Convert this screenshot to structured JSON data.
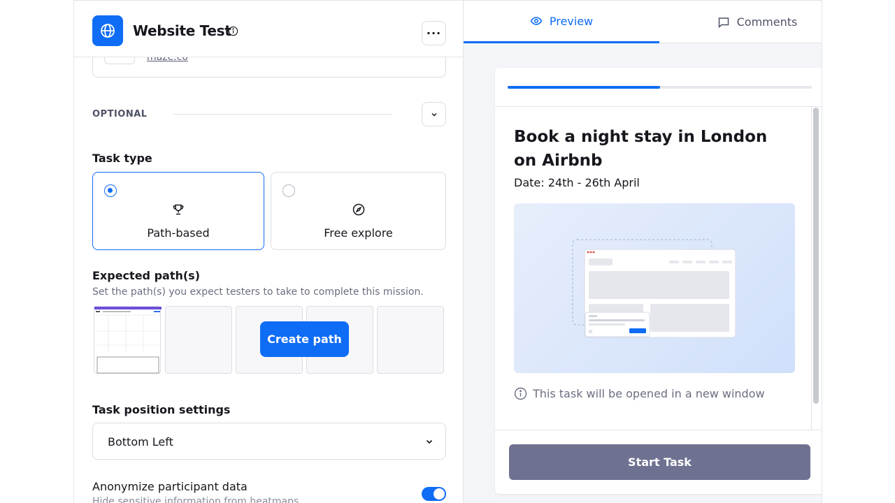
{
  "header": {
    "title": "Website Test",
    "more_label": "···"
  },
  "url_card": {
    "url": "maze.co"
  },
  "optional": {
    "label": "OPTIONAL"
  },
  "task_type": {
    "label": "Task type",
    "options": [
      {
        "label": "Path-based",
        "selected": true,
        "icon": "trophy-icon"
      },
      {
        "label": "Free explore",
        "selected": false,
        "icon": "compass-icon"
      }
    ]
  },
  "expected_paths": {
    "label": "Expected path(s)",
    "description": "Set the path(s) you expect testers to take to complete this mission.",
    "create_label": "Create path"
  },
  "task_position": {
    "label": "Task position settings",
    "value": "Bottom Left"
  },
  "anonymize": {
    "label": "Anonymize participant data",
    "description": "Hide sensitive information from heatmaps",
    "enabled": true
  },
  "tabs": [
    {
      "label": "Preview",
      "active": true,
      "icon": "eye-icon"
    },
    {
      "label": "Comments",
      "active": false,
      "icon": "comment-icon"
    }
  ],
  "preview": {
    "progress": 0.5,
    "task_title": "Book a night stay in London on Airbnb",
    "task_date": "Date: 24th - 26th April",
    "new_window_note": "This task will be opened in a new window",
    "start_label": "Start Task"
  },
  "colors": {
    "accent": "#0f6cf5",
    "start_button": "#6e7190"
  }
}
